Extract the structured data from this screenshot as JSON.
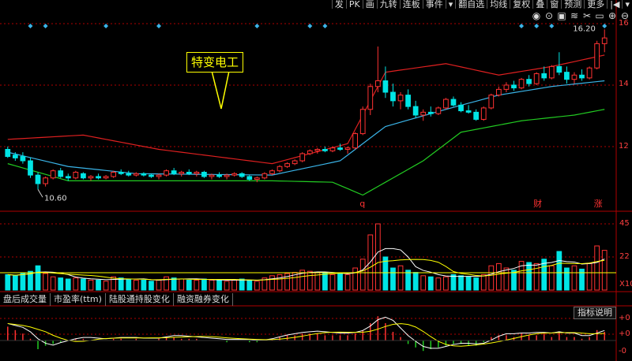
{
  "toolbar": {
    "items": [
      "发",
      "PK",
      "画",
      "九转",
      "连板",
      "事件",
      "▾",
      "翻自选",
      "均线",
      "复权",
      "叠",
      "窗",
      "预测",
      "更多",
      "|◀",
      "▾"
    ]
  },
  "icons": [
    "eye-icon",
    "lock-icon",
    "camera-icon",
    "wave-icon",
    "scissors-icon",
    "monitor-icon",
    "zoom-in-icon",
    "zoom-out-icon"
  ],
  "tabs": [
    "盘后成交量",
    "市盈率(ttm)",
    "陆股通持股变化",
    "融资融券变化"
  ],
  "explain_button": "指标说明",
  "price_axis_labels": [
    "16",
    "14",
    "12"
  ],
  "volume_axis_labels": [
    "45",
    "22",
    "X10"
  ],
  "macd_axis_labels": [
    "+0",
    "+0",
    "-0"
  ],
  "event_markers": [
    "q",
    "财",
    "涨"
  ],
  "annotation_label": "特变电工",
  "colors": {
    "up": "#ff3232",
    "down": "#00e5e5",
    "ma_white": "#ffffff",
    "ma_yellow": "#ffff00",
    "boll_upper": "#e02020",
    "boll_mid": "#3ab4e8",
    "boll_lower": "#22cc22",
    "grid": "#b00000"
  },
  "chart_data": {
    "type": "candlestick",
    "y_range": [
      10.0,
      16.4
    ],
    "high_label": "16.20",
    "low_label": "10.60",
    "candles": [
      [
        12.0,
        12.1,
        11.7,
        11.75
      ],
      [
        11.8,
        11.9,
        11.6,
        11.7
      ],
      [
        11.75,
        11.9,
        11.5,
        11.6
      ],
      [
        11.6,
        11.7,
        11.0,
        11.1
      ],
      [
        11.1,
        11.2,
        10.6,
        10.8
      ],
      [
        10.8,
        11.05,
        10.7,
        11.0
      ],
      [
        11.0,
        11.3,
        10.95,
        11.25
      ],
      [
        11.25,
        11.35,
        11.0,
        11.05
      ],
      [
        11.05,
        11.15,
        10.9,
        11.0
      ],
      [
        11.0,
        11.25,
        10.95,
        11.2
      ],
      [
        11.15,
        11.2,
        10.95,
        11.0
      ],
      [
        11.0,
        11.1,
        10.9,
        11.05
      ],
      [
        11.05,
        11.15,
        10.95,
        11.0
      ],
      [
        11.0,
        11.1,
        10.95,
        11.05
      ],
      [
        11.05,
        11.25,
        11.0,
        11.2
      ],
      [
        11.2,
        11.3,
        11.1,
        11.15
      ],
      [
        11.15,
        11.25,
        11.05,
        11.1
      ],
      [
        11.1,
        11.2,
        11.05,
        11.15
      ],
      [
        11.15,
        11.2,
        11.05,
        11.1
      ],
      [
        11.1,
        11.15,
        11.0,
        11.05
      ],
      [
        11.05,
        11.15,
        10.95,
        11.1
      ],
      [
        11.1,
        11.3,
        11.05,
        11.25
      ],
      [
        11.25,
        11.35,
        11.1,
        11.15
      ],
      [
        11.15,
        11.25,
        11.05,
        11.2
      ],
      [
        11.2,
        11.3,
        11.1,
        11.15
      ],
      [
        11.15,
        11.25,
        11.05,
        11.2
      ],
      [
        11.2,
        11.25,
        11.0,
        11.05
      ],
      [
        11.05,
        11.15,
        10.95,
        11.1
      ],
      [
        11.1,
        11.2,
        11.0,
        11.05
      ],
      [
        11.05,
        11.15,
        10.95,
        11.1
      ],
      [
        11.1,
        11.2,
        11.05,
        11.15
      ],
      [
        11.15,
        11.2,
        11.0,
        11.05
      ],
      [
        11.05,
        11.1,
        10.9,
        10.95
      ],
      [
        10.95,
        11.05,
        10.85,
        11.0
      ],
      [
        11.0,
        11.2,
        10.95,
        11.15
      ],
      [
        11.15,
        11.3,
        11.1,
        11.25
      ],
      [
        11.25,
        11.45,
        11.2,
        11.4
      ],
      [
        11.4,
        11.55,
        11.35,
        11.5
      ],
      [
        11.5,
        11.65,
        11.45,
        11.6
      ],
      [
        11.6,
        11.9,
        11.55,
        11.85
      ],
      [
        11.85,
        12.0,
        11.8,
        11.95
      ],
      [
        11.95,
        12.05,
        11.85,
        12.0
      ],
      [
        12.0,
        12.1,
        11.9,
        11.95
      ],
      [
        11.95,
        12.1,
        11.9,
        12.05
      ],
      [
        12.05,
        12.2,
        11.95,
        12.0
      ],
      [
        12.0,
        12.1,
        11.85,
        12.05
      ],
      [
        12.05,
        12.6,
        12.0,
        12.55
      ],
      [
        12.55,
        13.5,
        12.5,
        13.4
      ],
      [
        13.4,
        14.3,
        13.2,
        14.2
      ],
      [
        14.2,
        15.6,
        14.0,
        14.4
      ],
      [
        14.4,
        14.9,
        13.8,
        14.0
      ],
      [
        14.0,
        14.3,
        13.5,
        13.7
      ],
      [
        13.7,
        14.0,
        13.4,
        13.9
      ],
      [
        13.9,
        14.1,
        13.4,
        13.5
      ],
      [
        13.5,
        13.7,
        13.1,
        13.2
      ],
      [
        13.2,
        13.4,
        13.0,
        13.3
      ],
      [
        13.3,
        13.5,
        13.15,
        13.25
      ],
      [
        13.25,
        13.5,
        13.2,
        13.45
      ],
      [
        13.45,
        13.8,
        13.4,
        13.75
      ],
      [
        13.75,
        13.85,
        13.5,
        13.55
      ],
      [
        13.55,
        13.65,
        13.3,
        13.35
      ],
      [
        13.35,
        13.55,
        13.25,
        13.3
      ],
      [
        13.3,
        13.4,
        13.0,
        13.05
      ],
      [
        13.05,
        13.5,
        13.0,
        13.45
      ],
      [
        13.45,
        13.95,
        13.4,
        13.9
      ],
      [
        13.9,
        14.2,
        13.85,
        14.1
      ],
      [
        14.1,
        14.35,
        14.0,
        14.25
      ],
      [
        14.25,
        14.4,
        14.05,
        14.15
      ],
      [
        14.15,
        14.5,
        14.1,
        14.45
      ],
      [
        14.45,
        14.6,
        14.2,
        14.3
      ],
      [
        14.3,
        14.7,
        14.25,
        14.65
      ],
      [
        14.65,
        14.9,
        14.4,
        14.5
      ],
      [
        14.5,
        14.95,
        14.45,
        14.9
      ],
      [
        14.9,
        15.4,
        14.6,
        14.7
      ],
      [
        14.7,
        14.9,
        14.3,
        14.45
      ],
      [
        14.45,
        14.7,
        14.3,
        14.6
      ],
      [
        14.6,
        14.8,
        14.4,
        14.5
      ],
      [
        14.5,
        14.9,
        14.45,
        14.85
      ],
      [
        14.85,
        15.8,
        14.8,
        15.7
      ],
      [
        15.7,
        16.2,
        15.4,
        15.9
      ]
    ],
    "boll_upper": [
      [
        0,
        12.35
      ],
      [
        10,
        12.5
      ],
      [
        20,
        12.0
      ],
      [
        35,
        11.5
      ],
      [
        45,
        12.2
      ],
      [
        50,
        14.7
      ],
      [
        58,
        15.0
      ],
      [
        65,
        14.6
      ],
      [
        72,
        14.9
      ],
      [
        79,
        15.3
      ]
    ],
    "boll_mid": [
      [
        0,
        11.9
      ],
      [
        8,
        11.4
      ],
      [
        17,
        11.15
      ],
      [
        35,
        11.1
      ],
      [
        44,
        11.6
      ],
      [
        50,
        12.8
      ],
      [
        58,
        13.4
      ],
      [
        65,
        13.9
      ],
      [
        72,
        14.2
      ],
      [
        79,
        14.4
      ]
    ],
    "boll_lower": [
      [
        0,
        11.5
      ],
      [
        8,
        10.9
      ],
      [
        17,
        10.9
      ],
      [
        35,
        10.9
      ],
      [
        43,
        10.85
      ],
      [
        47,
        10.4
      ],
      [
        55,
        11.6
      ],
      [
        60,
        12.6
      ],
      [
        68,
        13.0
      ],
      [
        75,
        13.2
      ],
      [
        79,
        13.4
      ]
    ],
    "volume": [
      14,
      13,
      15,
      17,
      22,
      15,
      12,
      11,
      10,
      11,
      10,
      9,
      9,
      8,
      12,
      11,
      10,
      9,
      9,
      8,
      9,
      12,
      11,
      10,
      9,
      9,
      10,
      9,
      9,
      8,
      9,
      10,
      9,
      8,
      11,
      13,
      14,
      15,
      16,
      18,
      17,
      16,
      15,
      14,
      15,
      14,
      20,
      28,
      50,
      60,
      30,
      20,
      22,
      18,
      16,
      13,
      12,
      11,
      12,
      14,
      13,
      12,
      11,
      14,
      22,
      24,
      20,
      18,
      26,
      25,
      24,
      28,
      22,
      35,
      20,
      22,
      19,
      24,
      40,
      36
    ],
    "volume_max": 60,
    "macd": [
      0.08,
      0.06,
      0.04,
      0.01,
      -0.05,
      -0.03,
      -0.02,
      -0.01,
      0.0,
      0.01,
      0.01,
      0.0,
      0.0,
      0.0,
      0.01,
      0.01,
      0.0,
      0.01,
      0.0,
      0.0,
      0.01,
      0.02,
      0.02,
      0.01,
      0.01,
      0.01,
      0.0,
      0.0,
      0.0,
      -0.01,
      0.0,
      0.0,
      -0.01,
      -0.01,
      0.0,
      0.01,
      0.02,
      0.03,
      0.03,
      0.04,
      0.04,
      0.04,
      0.03,
      0.03,
      0.03,
      0.03,
      0.04,
      0.06,
      0.1,
      0.14,
      0.1,
      0.05,
      0.02,
      -0.02,
      -0.04,
      -0.06,
      -0.05,
      -0.04,
      -0.03,
      -0.02,
      -0.02,
      -0.03,
      -0.03,
      -0.01,
      0.02,
      0.03,
      0.03,
      0.02,
      0.04,
      0.03,
      0.03,
      0.04,
      0.02,
      0.05,
      0.02,
      0.02,
      0.01,
      0.02,
      0.06,
      0.05
    ]
  }
}
